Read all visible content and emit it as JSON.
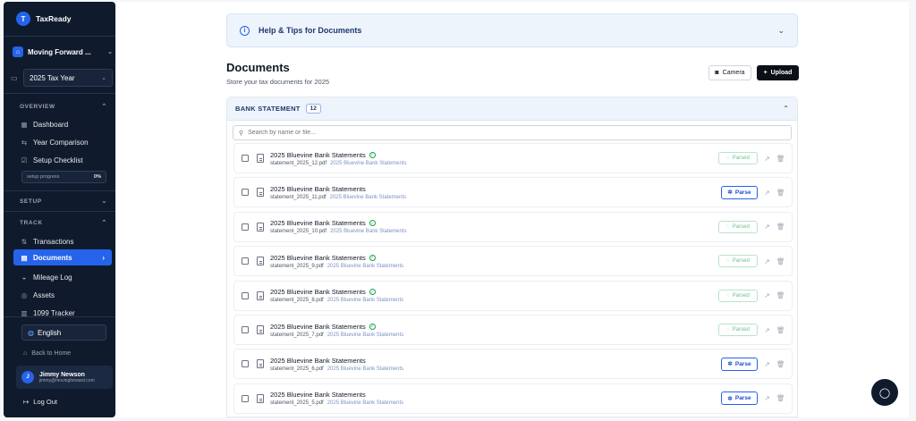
{
  "brand": {
    "logo_letter": "T",
    "name": "TaxReady"
  },
  "business": {
    "name": "Moving Forward ...",
    "icon": "business-icon"
  },
  "tax_year": {
    "label": "2025 Tax Year"
  },
  "sidebar": {
    "overview": {
      "header": "OVERVIEW",
      "items": [
        {
          "label": "Dashboard",
          "icon": "grid-icon"
        },
        {
          "label": "Year Comparison",
          "icon": "compare-icon"
        },
        {
          "label": "Setup Checklist",
          "icon": "checklist-icon"
        }
      ],
      "progress": {
        "label": "setup progress",
        "value": "0%"
      }
    },
    "setup": {
      "header": "SETUP"
    },
    "track": {
      "header": "TRACK",
      "items": [
        {
          "label": "Transactions",
          "icon": "arrows-icon"
        },
        {
          "label": "Documents",
          "icon": "document-icon"
        },
        {
          "label": "Mileage Log",
          "icon": "car-icon"
        },
        {
          "label": "Assets",
          "icon": "box-icon"
        },
        {
          "label": "1099 Tracker",
          "icon": "form-icon"
        }
      ]
    },
    "language": "English",
    "back_home": "Back to Home",
    "user": {
      "initial": "J",
      "name": "Jimmy Newson",
      "email": "jimmy@movingforward.com"
    },
    "logout": "Log Out"
  },
  "help": {
    "title": "Help & Tips for Documents"
  },
  "page": {
    "title": "Documents",
    "subtitle": "Store your tax documents for 2025"
  },
  "actions": {
    "camera": "Camera",
    "upload": "Upload"
  },
  "section": {
    "title": "BANK STATEMENT",
    "count": "12",
    "search_placeholder": "Search by name or file..."
  },
  "documents": [
    {
      "title": "2025 Bluevine Bank Statements",
      "file": "statement_2025_12.pdf",
      "tag": "2025 Bluevine Bank Statements",
      "parsed": true,
      "status": "Parsed"
    },
    {
      "title": "2025 Bluevine Bank Statements",
      "file": "statement_2025_11.pdf",
      "tag": "2025 Bluevine Bank Statements",
      "parsed": false,
      "status": "Parse"
    },
    {
      "title": "2025 Bluevine Bank Statements",
      "file": "statement_2025_10.pdf",
      "tag": "2025 Bluevine Bank Statements",
      "parsed": true,
      "status": "Parsed"
    },
    {
      "title": "2025 Bluevine Bank Statements",
      "file": "statement_2025_9.pdf",
      "tag": "2025 Bluevine Bank Statements",
      "parsed": true,
      "status": "Parsed"
    },
    {
      "title": "2025 Bluevine Bank Statements",
      "file": "statement_2025_8.pdf",
      "tag": "2025 Bluevine Bank Statements",
      "parsed": true,
      "status": "Parsed"
    },
    {
      "title": "2025 Bluevine Bank Statements",
      "file": "statement_2025_7.pdf",
      "tag": "2025 Bluevine Bank Statements",
      "parsed": true,
      "status": "Parsed"
    },
    {
      "title": "2025 Bluevine Bank Statements",
      "file": "statement_2025_6.pdf",
      "tag": "2025 Bluevine Bank Statements",
      "parsed": false,
      "status": "Parse"
    },
    {
      "title": "2025 Bluevine Bank Statements",
      "file": "statement_2025_5.pdf",
      "tag": "2025 Bluevine Bank Statements",
      "parsed": false,
      "status": "Parse"
    }
  ],
  "colors": {
    "sidebar": "#0f1b2d",
    "accent": "#2563eb",
    "parsed": "#16a34a"
  }
}
